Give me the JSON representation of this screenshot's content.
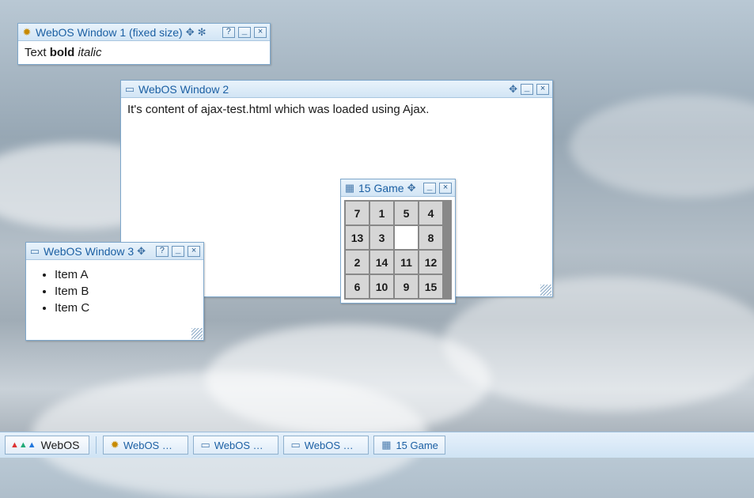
{
  "windows": {
    "w1": {
      "title": "WebOS Window 1 (fixed size)",
      "content": {
        "text": "Text ",
        "bold": "bold",
        "italic": " italic"
      }
    },
    "w2": {
      "title": "WebOS Window 2",
      "content": "It's content of ajax-test.html which was loaded using Ajax."
    },
    "w3": {
      "title": "WebOS Window 3",
      "items": [
        "Item A",
        "Item B",
        "Item C"
      ]
    },
    "game": {
      "title": "15 Game",
      "tiles": [
        "7",
        "1",
        "5",
        "4",
        "13",
        "3",
        "",
        "8",
        "2",
        "14",
        "11",
        "12",
        "6",
        "10",
        "9",
        "15"
      ]
    }
  },
  "controls": {
    "move": "✥",
    "settings": "✻",
    "help": "?",
    "minimize": "_",
    "close": "×"
  },
  "taskbar": {
    "start": "WebOS",
    "items": [
      {
        "icon": "gear",
        "label": "WebOS Wind..."
      },
      {
        "icon": "app",
        "label": "WebOS Wind..."
      },
      {
        "icon": "app",
        "label": "WebOS Wind..."
      },
      {
        "icon": "grid",
        "label": "15 Game"
      }
    ]
  }
}
